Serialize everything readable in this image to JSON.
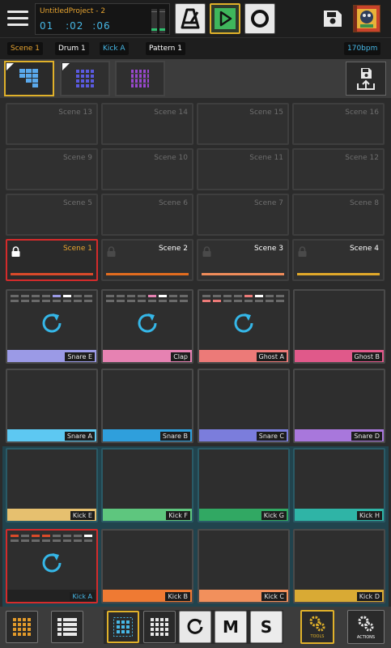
{
  "header": {
    "project_name": "UntitledProject - 2",
    "time": {
      "minutes": "01",
      "seconds": "02",
      "frames": "06"
    },
    "icons": {
      "menu": "hamburger-icon",
      "metronome": "metronome-icon",
      "play": "play-icon",
      "record": "record-icon",
      "save": "save-icon",
      "avatar": "project-avatar"
    }
  },
  "tags": {
    "scene": "Scene 1",
    "drum": "Drum 1",
    "kit": "Kick A",
    "pattern": "Pattern 1",
    "bpm": "170bpm"
  },
  "colors": {
    "accent_gold": "#e0b12a",
    "accent_blue": "#47b8e6",
    "select_red": "#d42b2b",
    "play_green": "#3fb65c"
  },
  "scenes": [
    {
      "label": "Scene 13"
    },
    {
      "label": "Scene 14"
    },
    {
      "label": "Scene 15"
    },
    {
      "label": "Scene 16"
    },
    {
      "label": "Scene 9"
    },
    {
      "label": "Scene 10"
    },
    {
      "label": "Scene 11"
    },
    {
      "label": "Scene 12"
    },
    {
      "label": "Scene 5"
    },
    {
      "label": "Scene 6"
    },
    {
      "label": "Scene 7"
    },
    {
      "label": "Scene 8"
    },
    {
      "label": "Scene 1",
      "locked": true,
      "selected": true,
      "bar_color": "#d94a2a"
    },
    {
      "label": "Scene 2",
      "locked": true,
      "bar_color": "#e26c1f"
    },
    {
      "label": "Scene 3",
      "locked": true,
      "bar_color": "#ef8c5a"
    },
    {
      "label": "Scene 4",
      "locked": true,
      "bar_color": "#e0a82a"
    }
  ],
  "pads": [
    {
      "name": "Snare E",
      "color": "#9b9ae6",
      "playing": true
    },
    {
      "name": "Clap",
      "color": "#e682b2",
      "playing": true
    },
    {
      "name": "Ghost A",
      "color": "#ec7a78",
      "playing": true
    },
    {
      "name": "Ghost B",
      "color": "#e0598a"
    },
    {
      "name": "Snare A",
      "color": "#5dc8f2"
    },
    {
      "name": "Snare B",
      "color": "#2f9fdc"
    },
    {
      "name": "Snare C",
      "color": "#7b7ddc"
    },
    {
      "name": "Snare D",
      "color": "#a877dc"
    },
    {
      "name": "Kick E",
      "color": "#e6c06f"
    },
    {
      "name": "Kick F",
      "color": "#5ec67e"
    },
    {
      "name": "Kick G",
      "color": "#31a863"
    },
    {
      "name": "Kick H",
      "color": "#2fb4a6"
    },
    {
      "name": "Kick A",
      "color": "#222222",
      "playing": true,
      "selected": true
    },
    {
      "name": "Kick B",
      "color": "#ef7a33"
    },
    {
      "name": "Kick C",
      "color": "#f2905c"
    },
    {
      "name": "Kick D",
      "color": "#d9aa34"
    }
  ],
  "bottom": {
    "m_label": "M",
    "s_label": "S",
    "tools_label": "TOOLS",
    "actions_label": "ACTIONS"
  }
}
